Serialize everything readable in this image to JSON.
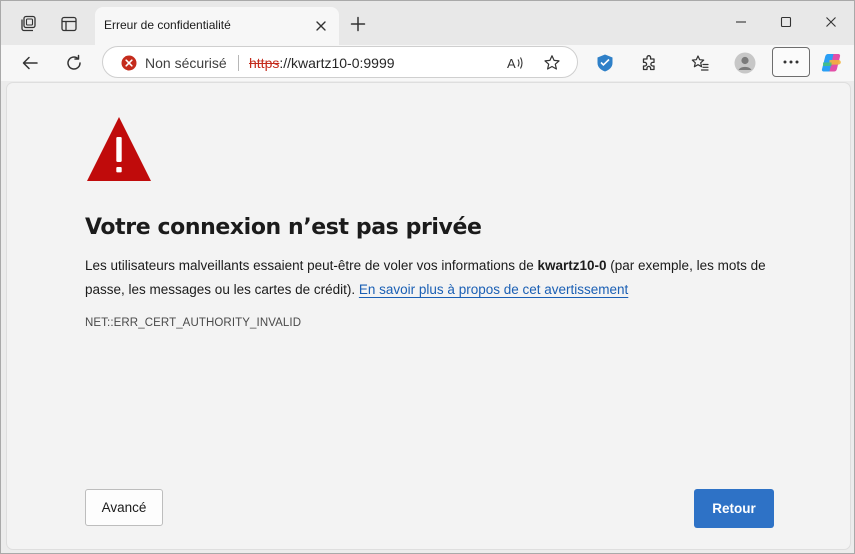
{
  "tab": {
    "title": "Erreur de confidentialité"
  },
  "omnibox": {
    "security_label": "Non sécurisé",
    "url_scheme": "https",
    "url_rest": "://kwartz10-0:9999"
  },
  "page": {
    "heading": "Votre connexion n’est pas privée",
    "para_before": "Les utilisateurs malveillants essaient peut-être de voler vos informations de ",
    "host_bold": "kwartz10-0",
    "para_after": " (par exemple, les mots de passe, les messages ou les cartes de crédit). ",
    "link_text": "En savoir plus à propos de cet avertissement",
    "error_code": "NET::ERR_CERT_AUTHORITY_INVALID",
    "advanced_button": "Avancé",
    "back_button": "Retour"
  },
  "colors": {
    "warning_red": "#c00b0b",
    "primary_button": "#2e72c6",
    "link": "#1a5fb4",
    "insecure_red": "#c42b1c"
  },
  "icons": [
    "workspaces-icon",
    "tab-actions-icon",
    "close-icon",
    "new-tab-icon",
    "minimize-icon",
    "maximize-icon",
    "window-close-icon",
    "back-icon",
    "refresh-icon",
    "not-secure-icon",
    "read-aloud-icon",
    "favorite-star-icon",
    "extension-shield-icon",
    "extensions-icon",
    "favorites-icon",
    "profile-icon",
    "more-icon",
    "copilot-icon",
    "warning-icon"
  ]
}
